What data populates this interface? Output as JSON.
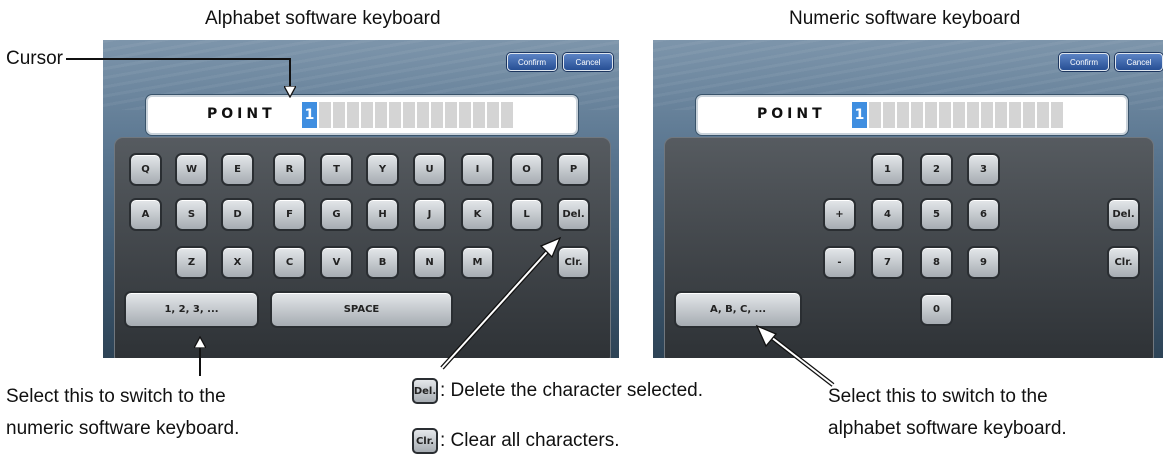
{
  "captions": {
    "alpha_title": "Alphabet software keyboard",
    "numeric_title": "Numeric software keyboard",
    "cursor_label": "Cursor",
    "switch_numeric_line1": "Select this to switch to the",
    "switch_numeric_line2": "numeric software keyboard.",
    "switch_alpha_line1": "Select this to switch to the",
    "switch_alpha_line2": "alphabet software keyboard.",
    "del_desc": ": Delete the character selected.",
    "clr_desc": ": Clear all characters."
  },
  "legend_keys": {
    "del": "Del.",
    "clr": "Clr."
  },
  "alpha": {
    "confirm": "Confirm",
    "cancel": "Cancel",
    "text": "POINT",
    "cursor_char": "1",
    "row1": [
      "Q",
      "W",
      "E",
      "R",
      "T",
      "Y",
      "U",
      "I",
      "O",
      "P"
    ],
    "row2": [
      "A",
      "S",
      "D",
      "F",
      "G",
      "H",
      "J",
      "K",
      "L",
      "Del."
    ],
    "row3": [
      "Z",
      "X",
      "C",
      "V",
      "B",
      "N",
      "M",
      "Clr."
    ],
    "switch_key": "1, 2, 3, ...",
    "space_key": "SPACE"
  },
  "numeric": {
    "confirm": "Confirm",
    "cancel": "Cancel",
    "text": "POINT",
    "cursor_char": "1",
    "row1": [
      "1",
      "2",
      "3"
    ],
    "row2": [
      "+",
      "4",
      "5",
      "6"
    ],
    "row3": [
      "-",
      "7",
      "8",
      "9"
    ],
    "zero": "0",
    "del": "Del.",
    "clr": "Clr.",
    "switch_key": "A, B, C, ..."
  }
}
